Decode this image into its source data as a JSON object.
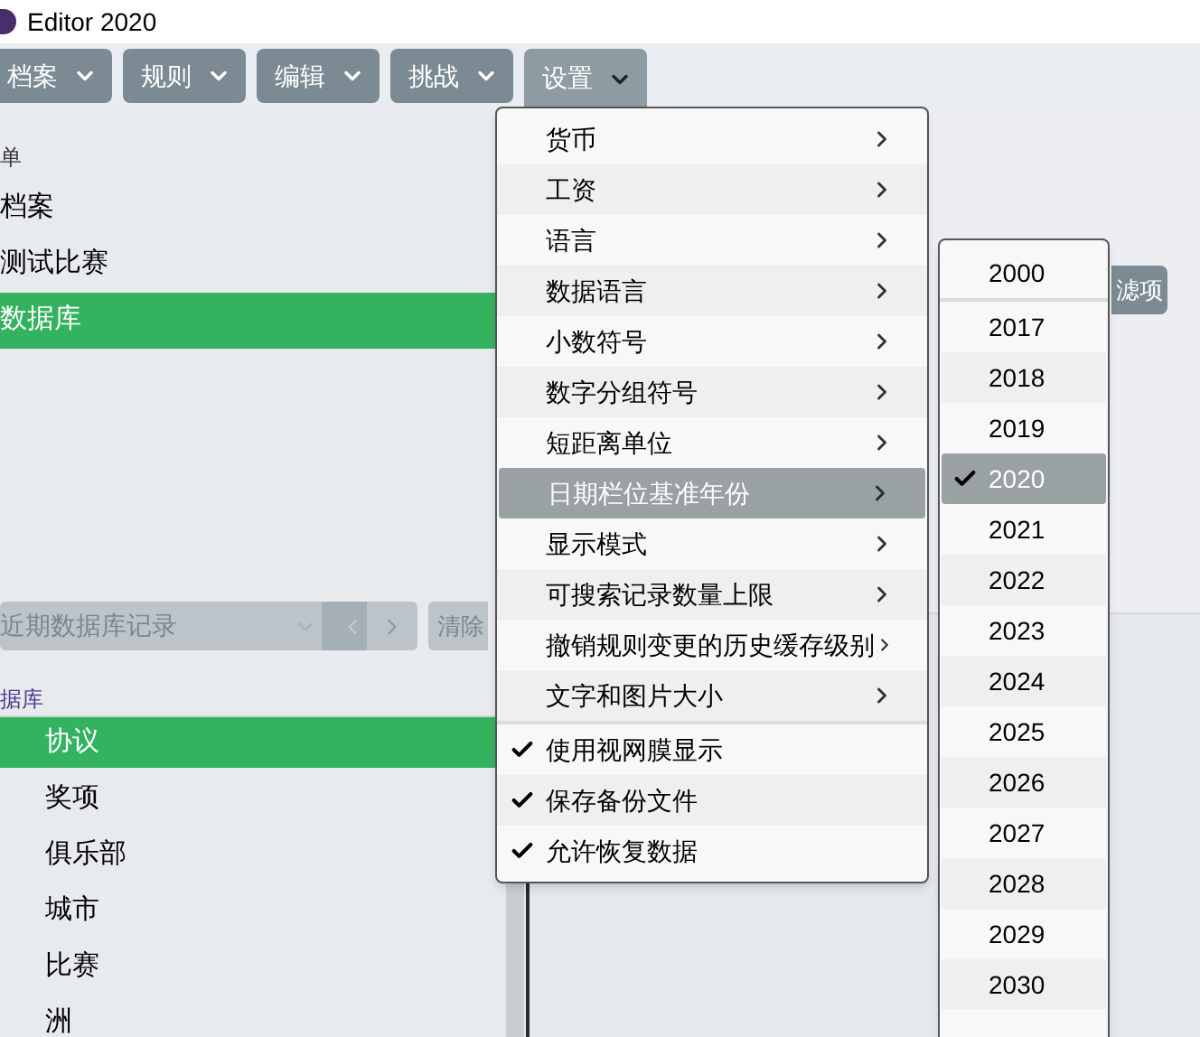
{
  "window": {
    "title": "Editor 2020"
  },
  "toolbar": [
    {
      "label": "档案",
      "expanded": false
    },
    {
      "label": "规则",
      "expanded": false
    },
    {
      "label": "编辑",
      "expanded": false
    },
    {
      "label": "挑战",
      "expanded": false
    },
    {
      "label": "设置",
      "expanded": true
    }
  ],
  "sidebar": {
    "header": "单",
    "items": [
      {
        "label": "档案",
        "selected": false
      },
      {
        "label": "测试比赛",
        "selected": false
      },
      {
        "label": "数据库",
        "selected": true
      }
    ]
  },
  "recent": {
    "placeholder": "近期数据库记录",
    "clear_button": "清除"
  },
  "database": {
    "header": "据库",
    "items": [
      {
        "label": "协议",
        "selected": true
      },
      {
        "label": "奖项",
        "selected": false
      },
      {
        "label": "俱乐部",
        "selected": false
      },
      {
        "label": "城市",
        "selected": false
      },
      {
        "label": "比赛",
        "selected": false
      },
      {
        "label": "洲",
        "selected": false
      }
    ]
  },
  "filter_button": "滤项",
  "settings_menu": {
    "groups": [
      [
        {
          "label": "货币",
          "kind": "submenu",
          "selected": false
        },
        {
          "label": "工资",
          "kind": "submenu",
          "selected": false
        },
        {
          "label": "语言",
          "kind": "submenu",
          "selected": false
        },
        {
          "label": "数据语言",
          "kind": "submenu",
          "selected": false
        },
        {
          "label": "小数符号",
          "kind": "submenu",
          "selected": false
        },
        {
          "label": "数字分组符号",
          "kind": "submenu",
          "selected": false
        },
        {
          "label": "短距离单位",
          "kind": "submenu",
          "selected": false
        },
        {
          "label": "日期栏位基准年份",
          "kind": "submenu",
          "selected": true
        },
        {
          "label": "显示模式",
          "kind": "submenu",
          "selected": false
        },
        {
          "label": "可搜索记录数量上限",
          "kind": "submenu",
          "selected": false
        },
        {
          "label": "撤销规则变更的历史缓存级别",
          "kind": "submenu",
          "selected": false
        },
        {
          "label": "文字和图片大小",
          "kind": "submenu",
          "selected": false
        }
      ],
      [
        {
          "label": "使用视网膜显示",
          "kind": "check",
          "checked": true,
          "selected": false
        },
        {
          "label": "保存备份文件",
          "kind": "check",
          "checked": true,
          "selected": false
        },
        {
          "label": "允许恢复数据",
          "kind": "check",
          "checked": true,
          "selected": false
        }
      ]
    ]
  },
  "year_menu": {
    "groups": [
      [
        {
          "label": "2000",
          "selected": false
        }
      ],
      [
        {
          "label": "2017",
          "selected": false
        },
        {
          "label": "2018",
          "selected": false
        },
        {
          "label": "2019",
          "selected": false
        },
        {
          "label": "2020",
          "selected": true
        },
        {
          "label": "2021",
          "selected": false
        },
        {
          "label": "2022",
          "selected": false
        },
        {
          "label": "2023",
          "selected": false
        },
        {
          "label": "2024",
          "selected": false
        },
        {
          "label": "2025",
          "selected": false
        },
        {
          "label": "2026",
          "selected": false
        },
        {
          "label": "2027",
          "selected": false
        },
        {
          "label": "2028",
          "selected": false
        },
        {
          "label": "2029",
          "selected": false
        },
        {
          "label": "2030",
          "selected": false
        }
      ]
    ]
  }
}
